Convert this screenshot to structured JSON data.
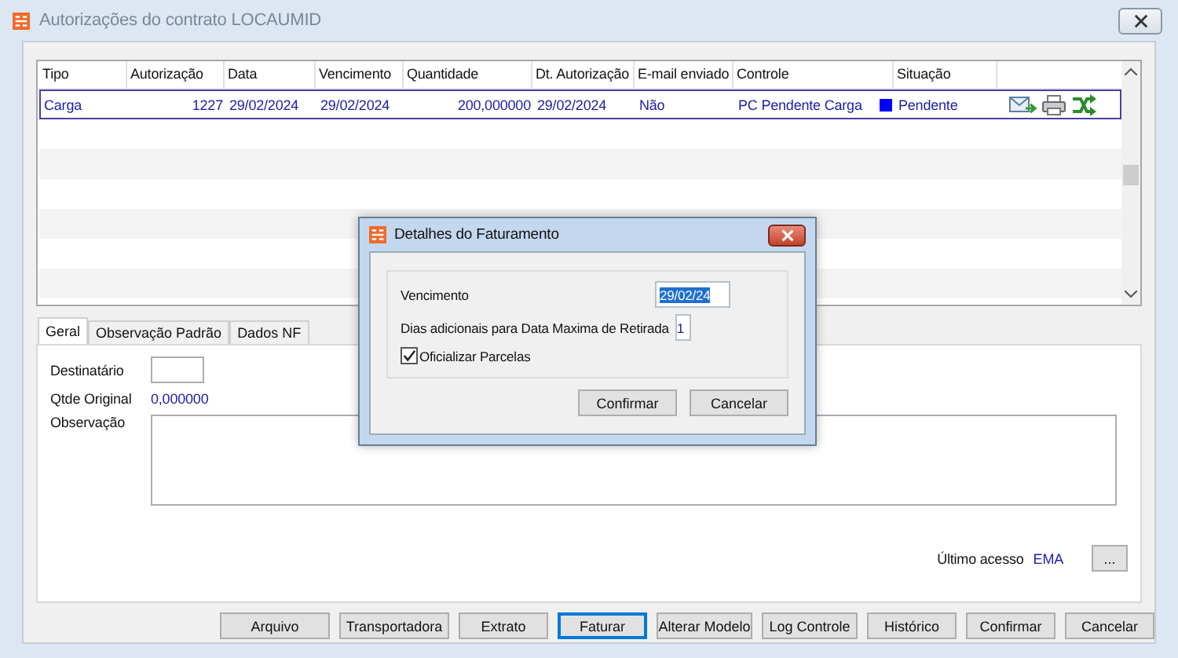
{
  "window": {
    "title": "Autorizações do contrato LOCAUMID"
  },
  "table": {
    "columns": [
      "Tipo",
      "Autorização",
      "Data",
      "Vencimento",
      "Quantidade",
      "Dt. Autorização",
      "E-mail enviado",
      "Controle",
      "Situação"
    ],
    "rows": [
      {
        "cells": [
          "Carga",
          "1227",
          "29/02/2024",
          "29/02/2024",
          "200,000000",
          "29/02/2024",
          "Não",
          "PC  Pendente Carga",
          "Pendente"
        ],
        "color": "#0000ff",
        "selected": true
      }
    ]
  },
  "tabs": [
    {
      "label": "Geral",
      "selected": true
    },
    {
      "label": "Observação Padrão",
      "selected": false
    },
    {
      "label": "Dados NF",
      "selected": false
    }
  ],
  "form": {
    "destinatario": {
      "label": "Destinatário"
    },
    "qtde_original": {
      "label": "Qtde Original",
      "value": "0,000000"
    },
    "observacao": {
      "label": "Observação"
    }
  },
  "last_access": {
    "label": "Último acesso",
    "value": "EMA",
    "button": "..."
  },
  "buttons": [
    {
      "label": "Arquivo",
      "focused": false
    },
    {
      "label": "Transportadora",
      "focused": false
    },
    {
      "label": "Extrato",
      "focused": false
    },
    {
      "label": "Faturar",
      "focused": true
    },
    {
      "label": "Alterar Modelo",
      "focused": false
    },
    {
      "label": "Log Controle",
      "focused": false
    },
    {
      "label": "Histórico",
      "focused": false
    },
    {
      "label": "Confirmar",
      "focused": false
    },
    {
      "label": "Cancelar",
      "focused": false
    }
  ],
  "dialog": {
    "title": "Detalhes do Faturamento",
    "vencimento": {
      "label": "Vencimento",
      "value": "29/02/24"
    },
    "dias": {
      "label": "Dias adicionais para Data Maxima de Retirada",
      "value": "1"
    },
    "oficializar": {
      "label": "Oficializar Parcelas",
      "checked": true
    },
    "buttons": [
      "Confirmar",
      "Cancelar"
    ]
  }
}
